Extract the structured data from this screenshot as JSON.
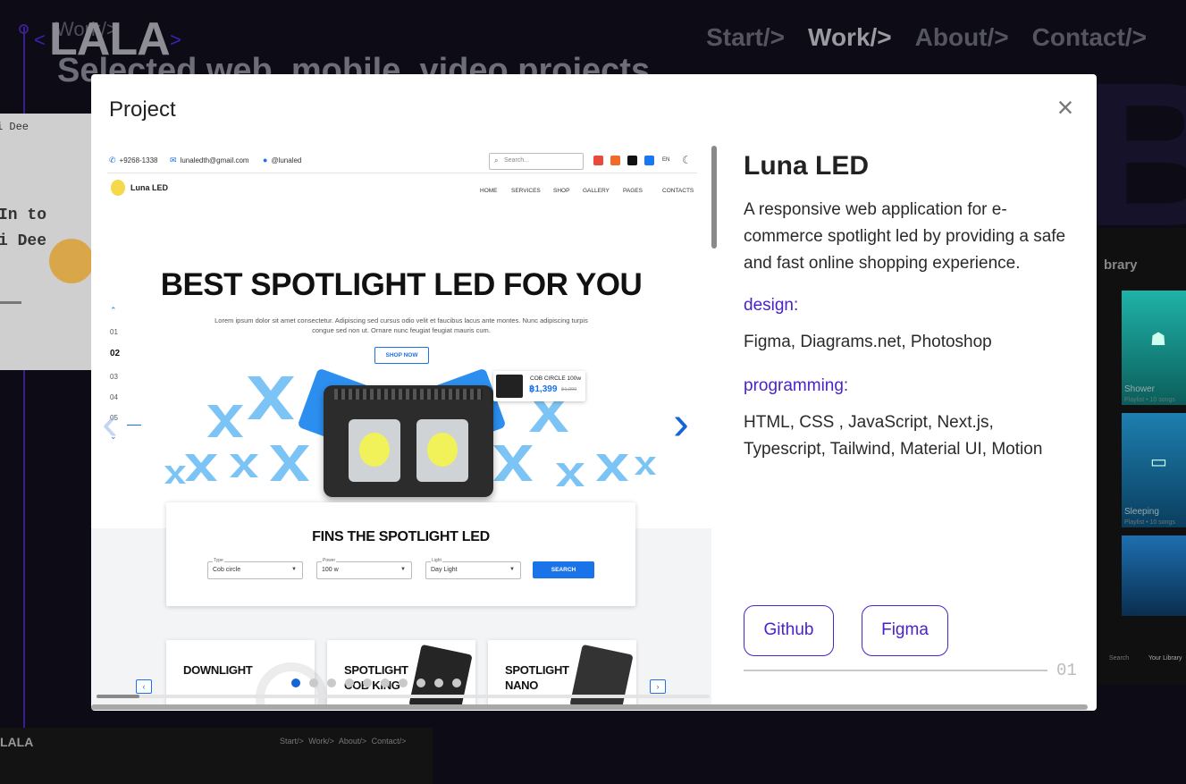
{
  "background": {
    "logo": "LALA",
    "logo_lt": "<",
    "logo_gt": ">",
    "work_ghost": "Work/>",
    "subtitle": "Selected web, mobile, video projects",
    "nav": [
      "Start/>",
      "Work/>",
      "About/>",
      "Contact/>"
    ],
    "big_letter": "B",
    "left_card": {
      "text1": "i Dee",
      "text2a": "In to",
      "text2b": "i Dee"
    },
    "right_card": {
      "header": "brary",
      "tiles": [
        {
          "label": "Shower",
          "sub": "Playlist • 10 songs",
          "icon": "☗"
        },
        {
          "label": "Sleeping",
          "sub": "Playlist • 10 songs",
          "icon": "▭"
        }
      ],
      "tab1": "Search",
      "tab2": "Your Library"
    },
    "bottom_thumb": {
      "logo": "LALA",
      "nav": "Start/> Work/> About/> Contact/>"
    }
  },
  "modal": {
    "title": "Project",
    "close_label": "×",
    "preview": {
      "contact_phone": "+9268-1338",
      "contact_email": "lunaledth@gmail.com",
      "contact_social": "@lunaled",
      "search_placeholder": "Search...",
      "lang": "EN",
      "brand": "Luna LED",
      "menu": [
        "HOME",
        "SERVICES",
        "SHOP",
        "GALLERY",
        "PAGES",
        "CONTACTS"
      ],
      "side_nav": [
        "01",
        "02",
        "03",
        "04",
        "05"
      ],
      "hero_title": "BEST SPOTLIGHT LED FOR YOU",
      "hero_desc": "Lorem ipsum dolor sit amet consectetur. Adipiscing sed cursus odio velit et faucibus lacus ante montes. Nunc adipiscing turpis congue sed non ut. Ornare nunc feugiat feugiat mauris cum.",
      "shop_button": "SHOP NOW",
      "price_card": {
        "name": "COB CIRCLE 100w",
        "price": "฿1,399",
        "old_price": "฿1,999"
      },
      "find_title": "FINS THE SPOTLIGHT LED",
      "filters": [
        {
          "label": "Type",
          "value": "Cob circle"
        },
        {
          "label": "Power",
          "value": "100 w"
        },
        {
          "label": "Light",
          "value": "Day Light"
        }
      ],
      "search_button": "SEARCH",
      "products": [
        {
          "name_line1": "DOWNLIGHT",
          "name_line2": ""
        },
        {
          "name_line1": "SPOTLIGHT",
          "name_line2": "COB KING"
        },
        {
          "name_line1": "SPOTLIGHT",
          "name_line2": "NANO"
        }
      ],
      "small_prev": "‹",
      "small_next": "›"
    },
    "carousel": {
      "prev_label": "‹",
      "next_label": "›",
      "dot_count": 10,
      "active_dot": 0
    },
    "info": {
      "name": "Luna LED",
      "description": "A responsive web application for e-commerce spotlight led by providing a safe and fast online shopping experience.",
      "design_label": "design:",
      "design_value": "Figma, Diagrams.net, Photoshop",
      "programming_label": "programming:",
      "programming_value": "HTML, CSS , JavaScript, Next.js, Typescript, Tailwind, Material UI, Motion",
      "buttons": [
        "Github",
        "Figma"
      ],
      "index": "01"
    }
  },
  "colors": {
    "accent": "#4b22c9",
    "carousel_blue": "#1565d8",
    "site_blue": "#1a73e8",
    "background": "#0d0b16"
  }
}
